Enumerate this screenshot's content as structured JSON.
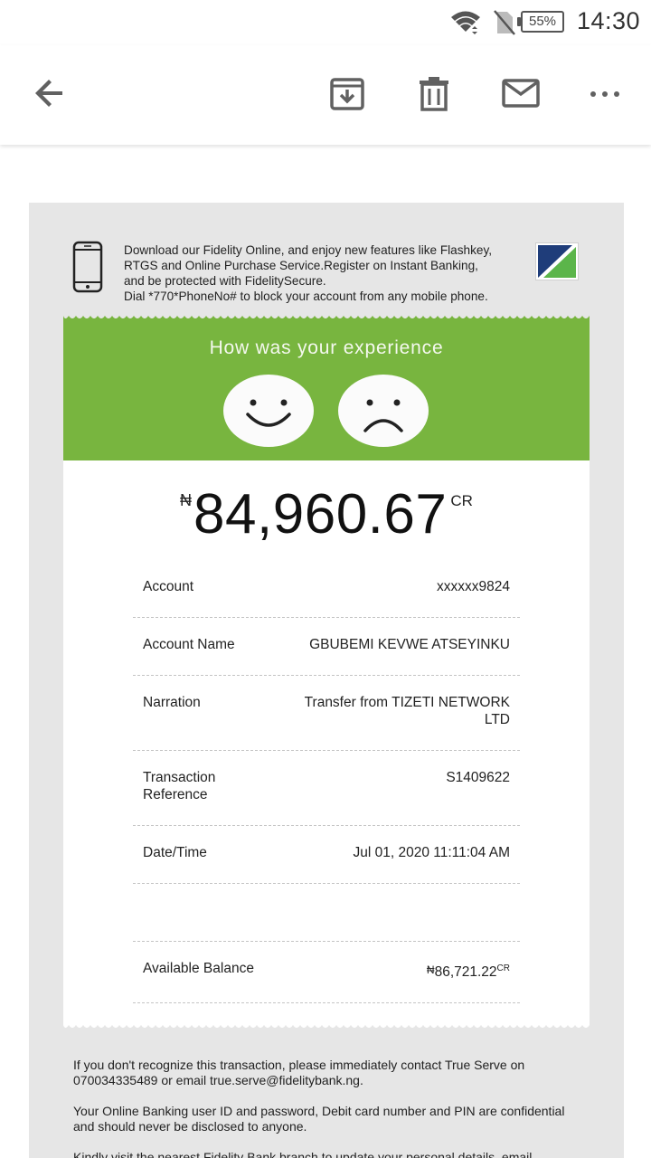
{
  "status_bar": {
    "battery": "55%",
    "time": "14:30"
  },
  "toolbar": {
    "actions": [
      "back",
      "archive",
      "delete",
      "mark-unread",
      "more"
    ]
  },
  "promo": {
    "lines": [
      "Download our Fidelity Online, and enjoy new features like Flashkey,",
      "RTGS and Online Purchase Service.Register on Instant Banking,",
      "and be protected with FidelitySecure.",
      "Dial *770*PhoneNo# to block your account from any mobile phone."
    ]
  },
  "feedback": {
    "title": "How was your experience"
  },
  "transaction": {
    "currency_symbol": "₦",
    "amount": "84,960.67",
    "type": "CR",
    "rows": [
      {
        "label": "Account",
        "value": "xxxxxx9824"
      },
      {
        "label": "Account Name",
        "value": "GBUBEMI KEVWE ATSEYINKU"
      },
      {
        "label": "Narration",
        "value": "Transfer from TIZETI NETWORK LTD"
      },
      {
        "label": "Transaction Reference",
        "value": "S1409622"
      },
      {
        "label": "Date/Time",
        "value": "Jul 01, 2020 11:11:04 AM"
      },
      {
        "label": "",
        "value": ""
      },
      {
        "label": "Available Balance",
        "value": "86,721.22",
        "value_prefix": "₦",
        "value_suffix": "CR"
      }
    ]
  },
  "footer": {
    "paragraphs": [
      "If you don't recognize this transaction, please immediately contact True Serve on 070034335489 or email true.serve@fidelitybank.ng.",
      "Your Online Banking user ID and password, Debit card number and PIN are confidential and should never be disclosed to anyone.",
      "Kindly visit the nearest Fidelity Bank branch to update your personal details, email"
    ]
  },
  "colors": {
    "feedback_green": "#78b53f",
    "logo_navy": "#1f3d7a",
    "logo_green": "#5bb54a"
  }
}
